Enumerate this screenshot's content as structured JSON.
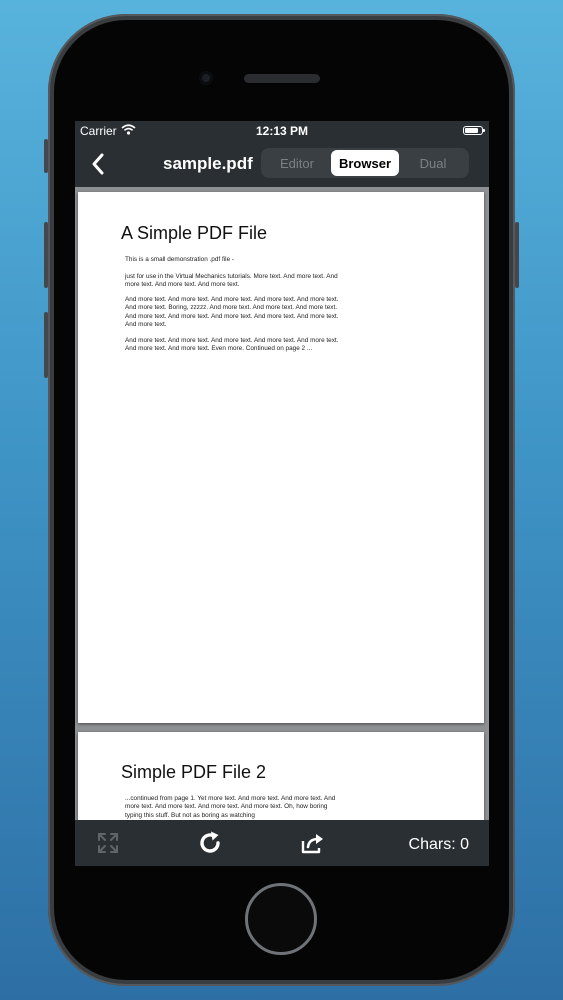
{
  "status": {
    "carrier": "Carrier",
    "time": "12:13 PM"
  },
  "nav": {
    "title": "sample.pdf",
    "segments": [
      "Editor",
      "Browser",
      "Dual"
    ],
    "active_segment": "Browser"
  },
  "document": {
    "page1": {
      "title": "A Simple PDF File",
      "paragraphs": [
        "This is a small demonstration .pdf file -",
        "just for use in the Virtual Mechanics tutorials. More text. And more text. And more text. And more text. And more text.",
        "And more text. And more text. And more text. And more text. And more text. And more text. Boring, zzzzz. And more text. And more text. And more text. And more text. And more text. And more text. And more text. And more text. And more text.",
        "And more text. And more text. And more text. And more text. And more text. And more text. And more text. Even more. Continued on page 2 ..."
      ]
    },
    "page2": {
      "title": "Simple PDF File 2",
      "paragraphs": [
        "...continued from page 1. Yet more text. And more text. And more text. And more text. And more text. And more text. And more text. Oh, how boring typing this stuff. But not as boring as watching"
      ]
    }
  },
  "toolbar": {
    "chars_label": "Chars: 0"
  },
  "icons": {
    "wifi": "wifi-icon",
    "battery": "battery-icon",
    "back": "chevron-left-icon",
    "fullscreen": "expand-icon",
    "refresh": "refresh-icon",
    "share": "share-icon"
  },
  "colors": {
    "background_top": "#58b3dc",
    "background_bottom": "#2d6fa5",
    "bar": "#2a2f33",
    "doc_background": "#8e9194",
    "segment_active": "#ffffff"
  }
}
